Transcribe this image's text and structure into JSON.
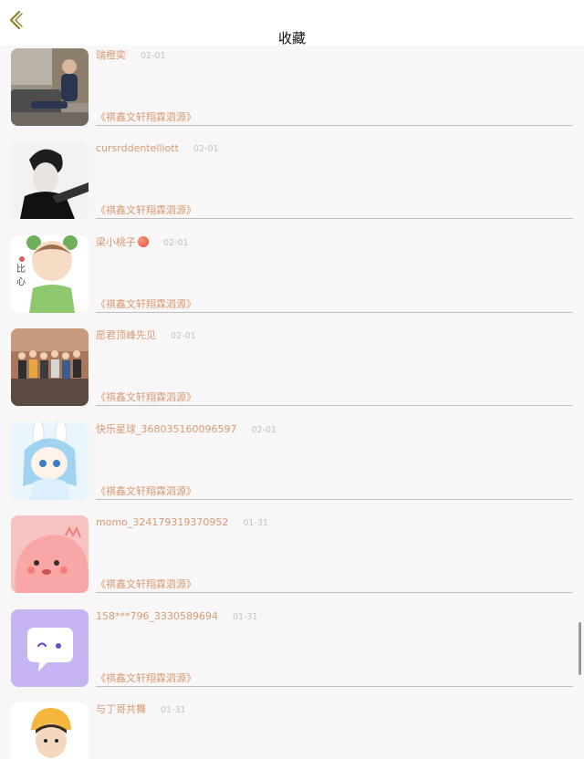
{
  "header": {
    "title": "收藏",
    "back_icon": "chevron-left-icon",
    "accent_color": "#9a8a2e"
  },
  "items": [
    {
      "name": "瑞橙奕",
      "date": "02-01",
      "tag": "《祺鑫文轩翔霖泗源》",
      "avatar": "photo-man-sofa"
    },
    {
      "name": "cursrddentelliott",
      "date": "02-01",
      "tag": "《祺鑫文轩翔霖泗源》",
      "avatar": "photo-bw-portrait"
    },
    {
      "name": "梁小桃子",
      "date": "02-01",
      "tag": "《祺鑫文轩翔霖泗源》",
      "avatar": "cartoon-frog-boy",
      "emoji": "peach"
    },
    {
      "name": "愿君顶峰先见",
      "date": "02-01",
      "tag": "《祺鑫文轩翔霖泗源》",
      "avatar": "photo-group"
    },
    {
      "name": "快乐星球_368035160096597",
      "date": "02-01",
      "tag": "《祺鑫文轩翔霖泗源》",
      "avatar": "anime-bunny-girl"
    },
    {
      "name": "momo_324179319370952",
      "date": "01-31",
      "tag": "《祺鑫文轩翔霖泗源》",
      "avatar": "pink-cartoon-dino"
    },
    {
      "name": "158***796_3330589694",
      "date": "01-31",
      "tag": "《祺鑫文轩翔霖泗源》",
      "avatar": "purple-chat-bubble"
    },
    {
      "name": "与丁哥共舞",
      "date": "01-31",
      "tag": "",
      "avatar": "photo-boy-yellow-hat"
    }
  ],
  "colors": {
    "name": "#d79a72",
    "date": "#c4c4c4",
    "divider": "#bfbfbf",
    "background": "#f8f6f7"
  }
}
